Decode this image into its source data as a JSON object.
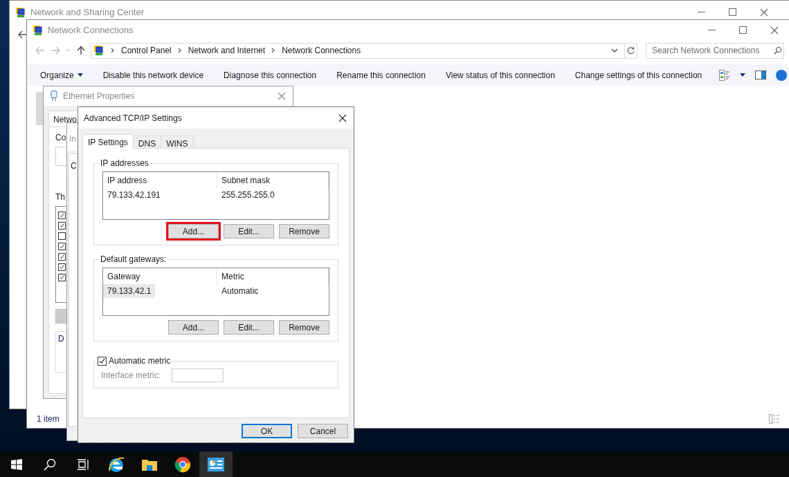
{
  "sharing_center": {
    "title": "Network and Sharing Center"
  },
  "connections": {
    "title": "Network Connections",
    "breadcrumb": [
      "Control Panel",
      "Network and Internet",
      "Network Connections"
    ],
    "search": {
      "placeholder": "Search Network Connections"
    },
    "commands": [
      {
        "label": "Organize",
        "kind": "menu"
      },
      {
        "label": "Disable this network device",
        "kind": "action"
      },
      {
        "label": "Diagnose this connection",
        "kind": "action"
      },
      {
        "label": "Rename this connection",
        "kind": "action"
      },
      {
        "label": "View status of this connection",
        "kind": "action"
      },
      {
        "label": "Change settings of this connection",
        "kind": "action"
      }
    ],
    "status": "1 item"
  },
  "ethernet_properties": {
    "title": "Ethernet Properties",
    "tab_label": "Netwo",
    "connect_label": "Co",
    "list_label": "Th",
    "frame_label": "D",
    "items": [
      {
        "checked": true
      },
      {
        "checked": true
      },
      {
        "checked": false
      },
      {
        "checked": true
      },
      {
        "checked": true
      },
      {
        "checked": true
      },
      {
        "checked": true
      }
    ]
  },
  "ipv4_properties": {
    "title": "In",
    "label": "C"
  },
  "advanced": {
    "title": "Advanced TCP/IP Settings",
    "tabs": [
      {
        "label": "IP Settings",
        "selected": true
      },
      {
        "label": "DNS",
        "selected": false
      },
      {
        "label": "WINS",
        "selected": false
      }
    ],
    "groups": [
      {
        "title": "IP addresses",
        "columns": [
          "IP address",
          "Subnet mask"
        ],
        "rows": [
          {
            "cells": [
              "79.133.42.191",
              "255.255.255.0"
            ],
            "selected": false
          }
        ],
        "buttons": [
          {
            "label": "Add...",
            "highlighted": true
          },
          {
            "label": "Edit...",
            "highlighted": false
          },
          {
            "label": "Remove",
            "highlighted": false
          }
        ]
      },
      {
        "title": "Default gateways:",
        "columns": [
          "Gateway",
          "Metric"
        ],
        "rows": [
          {
            "cells": [
              "79.133.42.1",
              "Automatic"
            ],
            "selected": true
          }
        ],
        "buttons": [
          {
            "label": "Add...",
            "highlighted": false
          },
          {
            "label": "Edit...",
            "highlighted": false
          },
          {
            "label": "Remove",
            "highlighted": false
          }
        ]
      }
    ],
    "automatic_metric": {
      "label": "Automatic metric",
      "checked": true
    },
    "interface_metric": {
      "label": "Interface metric:",
      "disabled": true
    },
    "buttons": [
      {
        "label": "OK",
        "default": true
      },
      {
        "label": "Cancel",
        "default": false
      }
    ]
  },
  "taskbar": {
    "items": [
      {
        "kind": "start",
        "active": false
      },
      {
        "kind": "search",
        "active": false
      },
      {
        "kind": "task-view",
        "active": false
      },
      {
        "kind": "browser-e",
        "active": false
      },
      {
        "kind": "folder",
        "active": false
      },
      {
        "kind": "browser-circle",
        "active": false
      },
      {
        "kind": "server-manager",
        "active": true
      }
    ]
  }
}
